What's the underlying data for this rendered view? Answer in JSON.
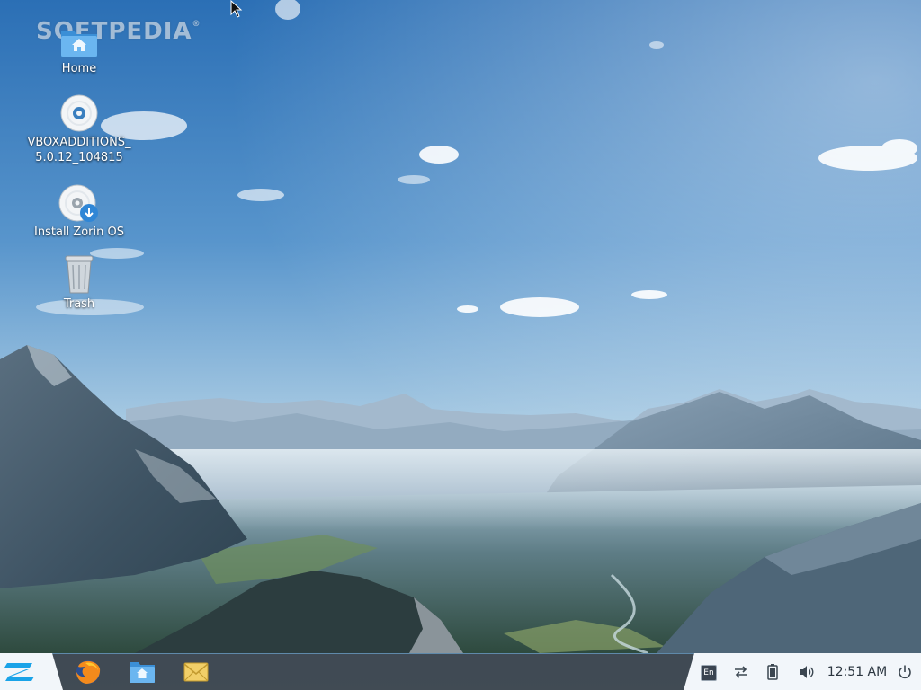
{
  "watermark": {
    "text": "SOFTPEDIA",
    "mark": "®"
  },
  "desktop": {
    "icons": [
      {
        "label": "Home",
        "icon": "home-folder-icon"
      },
      {
        "label": "VBOXADDITIONS_\n5.0.12_104815",
        "icon": "cd-disc-icon"
      },
      {
        "label": "Install Zorin OS",
        "icon": "install-disc-icon"
      },
      {
        "label": "Trash",
        "icon": "trash-icon"
      }
    ]
  },
  "taskbar": {
    "menu_icon": "zorin-logo-icon",
    "apps": [
      {
        "name": "firefox",
        "icon": "firefox-icon"
      },
      {
        "name": "files",
        "icon": "files-folder-icon"
      },
      {
        "name": "mail",
        "icon": "mail-icon"
      }
    ],
    "tray": {
      "language": "En",
      "network_icon": "network-arrows-icon",
      "battery_icon": "battery-icon",
      "volume_icon": "volume-icon",
      "clock": "12:51 AM",
      "power_icon": "power-icon"
    }
  },
  "colors": {
    "sky_top": "#2f73b8",
    "sky_bottom": "#cfe3ef",
    "taskbar_bg": "#1c2a36",
    "taskbar_accent": "#78bef0"
  }
}
